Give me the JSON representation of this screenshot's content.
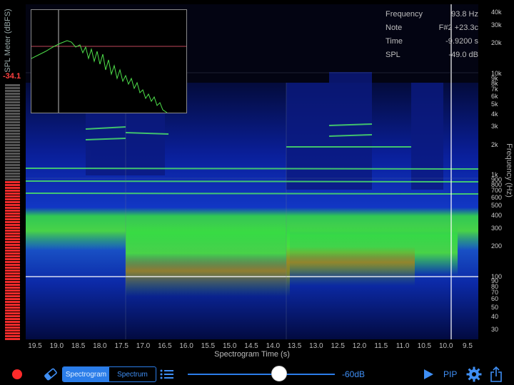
{
  "meter": {
    "title": "SPL Meter (dBFS)",
    "value": "-34.1",
    "level_fraction": 0.62,
    "accent": "#ee2a2a"
  },
  "readout": {
    "rows": [
      {
        "label": "Frequency",
        "value": "93.8 Hz"
      },
      {
        "label": "Note",
        "value": "F#2 +23.3c"
      },
      {
        "label": "Time",
        "value": "-9.9200 s"
      },
      {
        "label": "SPL",
        "value": "-49.0 dB"
      }
    ]
  },
  "freq_axis": {
    "title": "Frequency (Hz)",
    "ticks": [
      "40k",
      "30k",
      "20k",
      "10k",
      "9k",
      "8k",
      "7k",
      "6k",
      "5k",
      "4k",
      "3k",
      "2k",
      "1k",
      "900",
      "800",
      "700",
      "600",
      "500",
      "400",
      "300",
      "200",
      "100",
      "90",
      "80",
      "70",
      "60",
      "50",
      "40",
      "30"
    ]
  },
  "time_axis": {
    "title": "Spectrogram Time (s)",
    "ticks": [
      "19.5",
      "19.0",
      "18.5",
      "18.0",
      "17.5",
      "17.0",
      "16.5",
      "16.0",
      "15.5",
      "15.0",
      "14.5",
      "14.0",
      "13.5",
      "13.0",
      "12.5",
      "12.0",
      "11.5",
      "11.0",
      "10.5",
      "10.0",
      "9.5"
    ]
  },
  "toolbar": {
    "record_icon": "record-icon",
    "eraser_icon": "eraser-icon",
    "mode_spectrogram": "Spectrogram",
    "mode_spectrum": "Spectrum",
    "list_icon": "list-icon",
    "threshold_label": "-60dB",
    "threshold_fraction": 0.62,
    "play_icon": "play-icon",
    "pip_label": "PIP",
    "settings_icon": "gear-icon",
    "share_icon": "share-icon",
    "accent": "#2b7de9"
  }
}
